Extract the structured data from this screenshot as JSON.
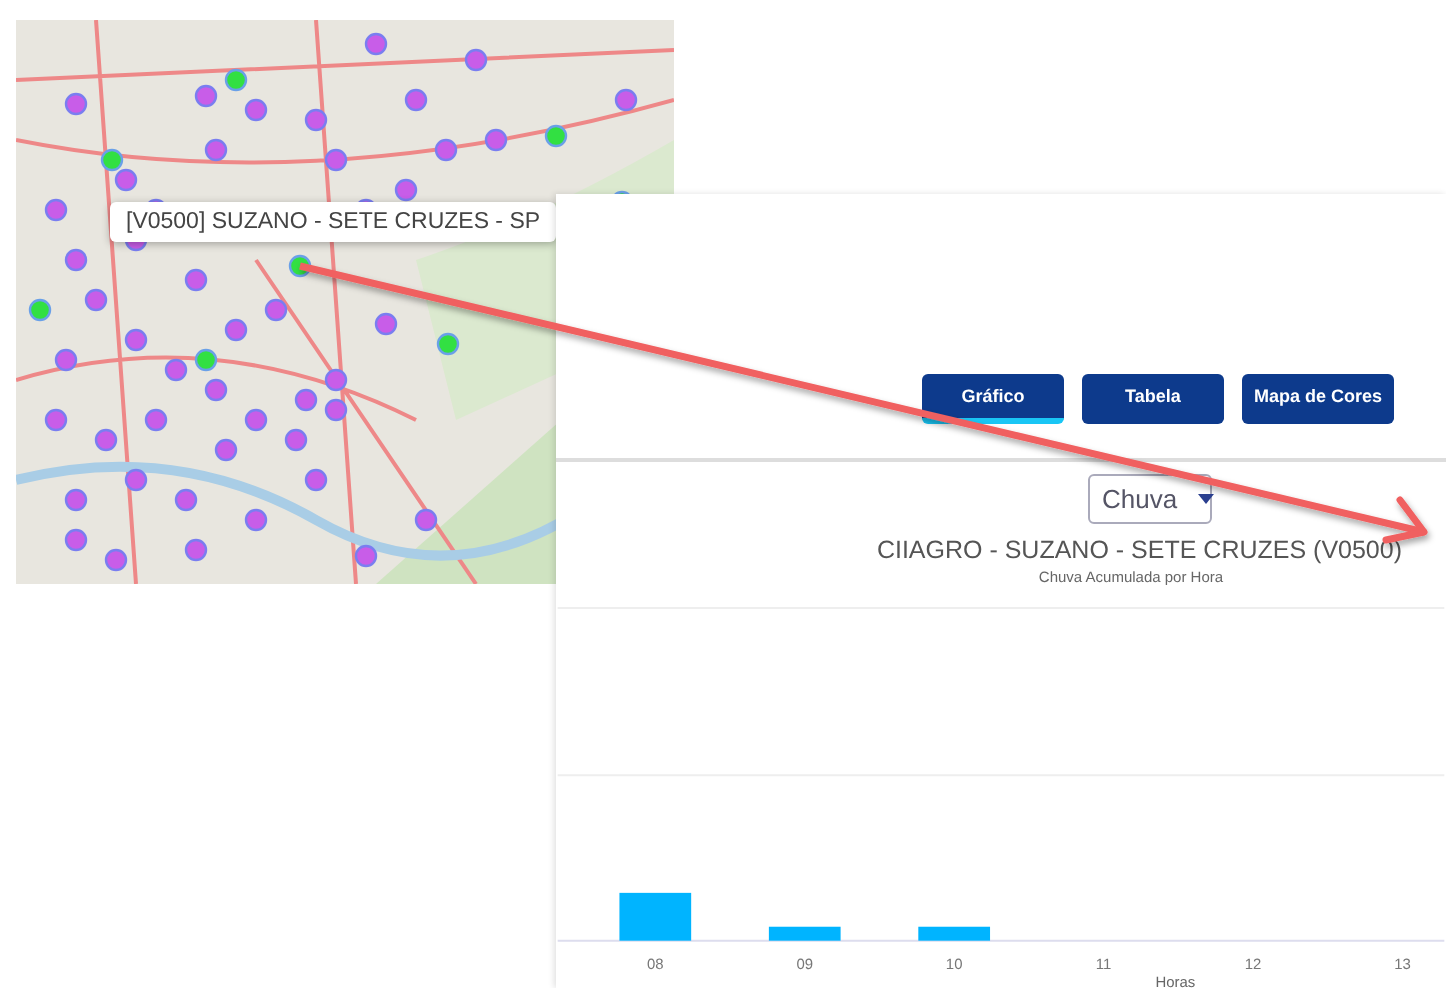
{
  "map": {
    "tooltip": "[V0500] SUZANO - SETE CRUZES - SP"
  },
  "tabs": [
    {
      "label": "Gráfico",
      "selected": true
    },
    {
      "label": "Tabela",
      "selected": false
    },
    {
      "label": "Mapa de Cores",
      "selected": false
    }
  ],
  "variable_select": {
    "value": "Chuva"
  },
  "chart": {
    "title": "CIIAGRO - SUZANO - SETE CRUZES (V0500)",
    "subtitle": "Chuva Acumulada por Hora",
    "categories": [
      "08",
      "09",
      "10",
      "11",
      "12",
      "13"
    ],
    "xlabel": "Horas"
  }
}
